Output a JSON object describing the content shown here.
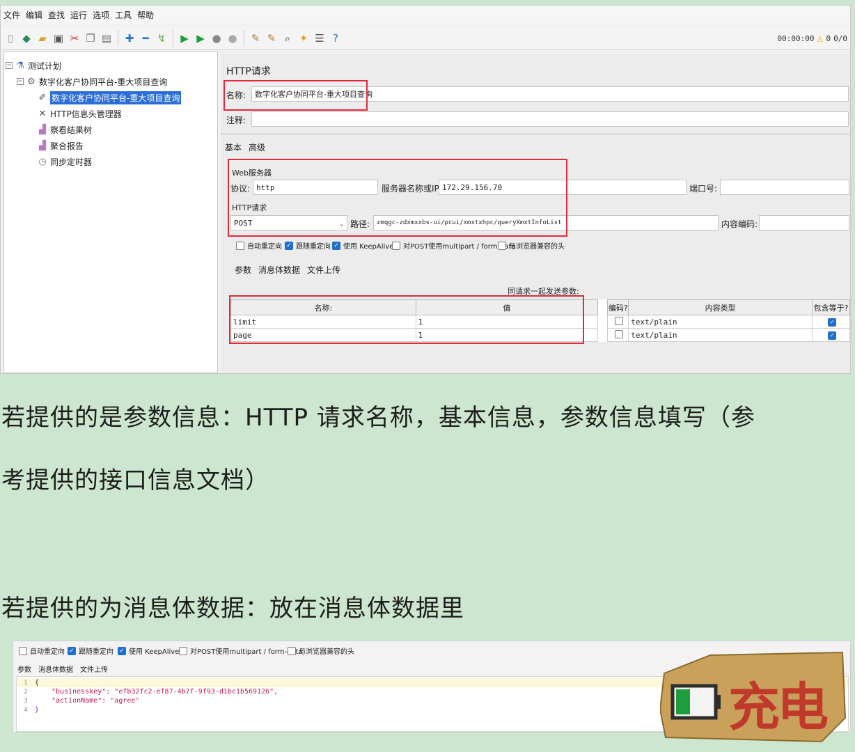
{
  "menu": [
    "文件",
    "编辑",
    "查找",
    "运行",
    "选项",
    "工具",
    "帮助"
  ],
  "status": {
    "timer": "00:00:00",
    "warnings": "0",
    "threads": "0/0"
  },
  "tree": {
    "root": "测试计划",
    "thread_group": "数字化客户协同平台-重大项目查询",
    "selected": "数字化客户协同平台-重大项目查询",
    "header_manager": "HTTP信息头管理器",
    "result_tree": "察看结果树",
    "aggregate_report": "聚合报告",
    "sync_timer": "同步定时器"
  },
  "panel": {
    "title": "HTTP请求",
    "name_label": "名称:",
    "name_value": "数字化客户协同平台-重大项目查询",
    "comment_label": "注释:",
    "tabs": [
      "基本",
      "高级"
    ],
    "web_server_label": "Web服务器",
    "protocol_label": "协议:",
    "protocol_value": "http",
    "server_label": "服务器名称或IP:",
    "server_value": "172.29.156.70",
    "port_label": "端口号:",
    "http_request_label": "HTTP请求",
    "method_value": "POST",
    "path_label": "路径:",
    "path_value": "zmqgc-zdxmxxbs-ui/pcui/xmxtxhpc/queryXmxtInfoList",
    "encoding_label": "内容编码:",
    "checkboxes": [
      "自动重定向",
      "跟随重定向",
      "使用 KeepAlive",
      "对POST使用multipart / form-data",
      "与浏览器兼容的头"
    ],
    "body_tabs": [
      "参数",
      "消息体数据",
      "文件上传"
    ],
    "send_params_label": "同请求一起发送参数:",
    "table_headers": [
      "名称:",
      "值",
      "编码?",
      "内容类型",
      "包含等于?"
    ],
    "rows": [
      {
        "name": "limit",
        "value": "1",
        "type": "text/plain"
      },
      {
        "name": "page",
        "value": "1",
        "type": "text/plain"
      }
    ]
  },
  "text": {
    "para1_line1": "若提供的是参数信息：HTTP 请求名称，基本信息，参数信息填写（参",
    "para1_line2": "考提供的接口信息文档）",
    "para2": "若提供的为消息体数据：放在消息体数据里"
  },
  "bottom": {
    "checkboxes": [
      "自动重定向",
      "跟随重定向",
      "使用 KeepAlive",
      "对POST使用multipart / form-data",
      "与浏览器兼容的头"
    ],
    "tabs": [
      "参数",
      "消息体数据",
      "文件上传"
    ],
    "code_lines": [
      {
        "num": "1",
        "text": "{"
      },
      {
        "num": "2",
        "text": "\"businesskey\": \"efb32fc2-ef87-4b7f-9f93-d1bc1b569126\","
      },
      {
        "num": "3",
        "text": "\"actionName\": \"agree\""
      },
      {
        "num": "4",
        "text": "}"
      }
    ]
  },
  "watermark": {
    "text": "充电"
  },
  "colors": {
    "highlight_red": "#e12b3a",
    "selection_blue": "#2c6ed6",
    "background_green": "#cde6cf"
  }
}
